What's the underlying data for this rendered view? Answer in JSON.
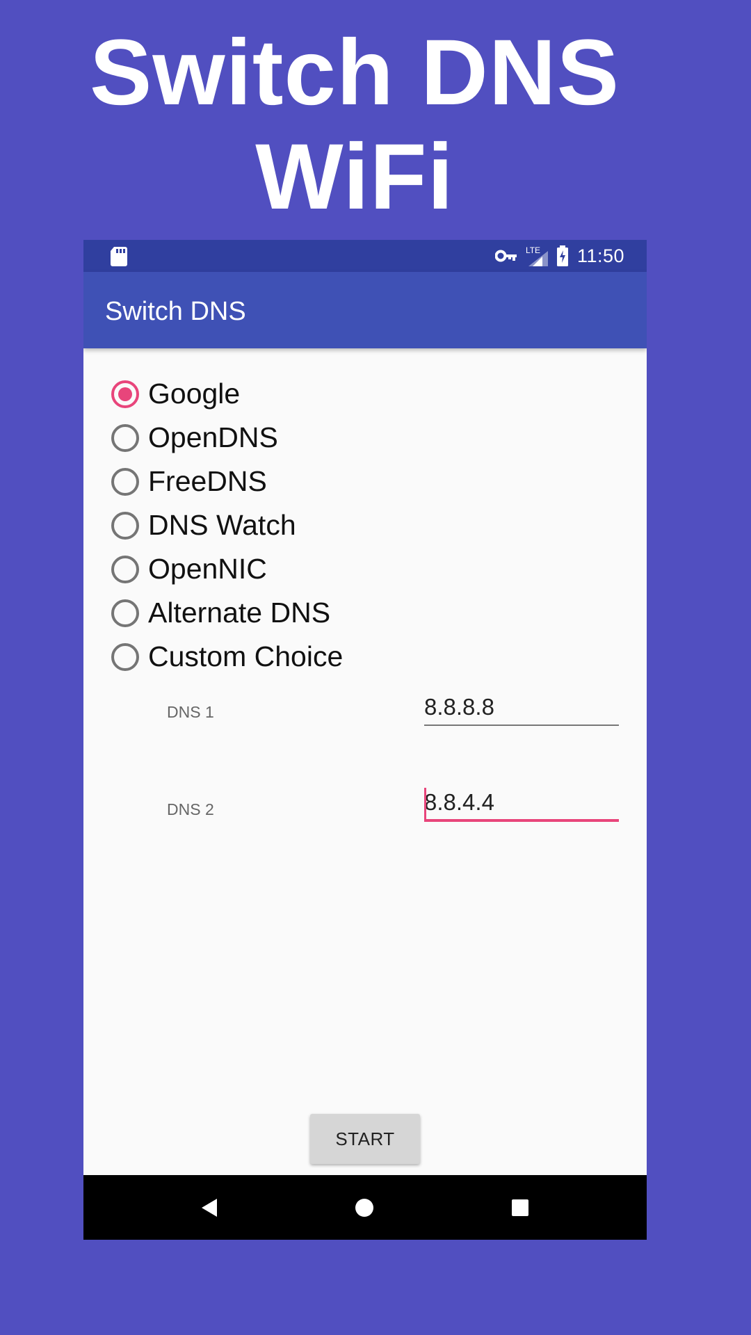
{
  "promo": {
    "line1": "Switch DNS",
    "line2": "WiFi"
  },
  "status_bar": {
    "time": "11:50",
    "icons": [
      "sd-card-icon",
      "vpn-key-icon",
      "lte-signal-icon",
      "battery-charging-icon"
    ],
    "lte_label": "LTE"
  },
  "app_bar": {
    "title": "Switch DNS"
  },
  "dns_options": [
    {
      "label": "Google",
      "checked": true
    },
    {
      "label": "OpenDNS",
      "checked": false
    },
    {
      "label": "FreeDNS",
      "checked": false
    },
    {
      "label": "DNS Watch",
      "checked": false
    },
    {
      "label": "OpenNIC",
      "checked": false
    },
    {
      "label": "Alternate DNS",
      "checked": false
    },
    {
      "label": "Custom Choice",
      "checked": false
    }
  ],
  "fields": {
    "dns1": {
      "label": "DNS 1",
      "value": "8.8.8.8"
    },
    "dns2": {
      "label": "DNS 2",
      "value": "8.8.4.4"
    }
  },
  "start_button": {
    "label": "START"
  },
  "nav_bar": {
    "icons": [
      "back-icon",
      "home-icon",
      "recents-icon"
    ]
  },
  "colors": {
    "background": "#514fc0",
    "status_bar": "#303f9f",
    "app_bar": "#3f51b5",
    "accent": "#e8457b"
  }
}
